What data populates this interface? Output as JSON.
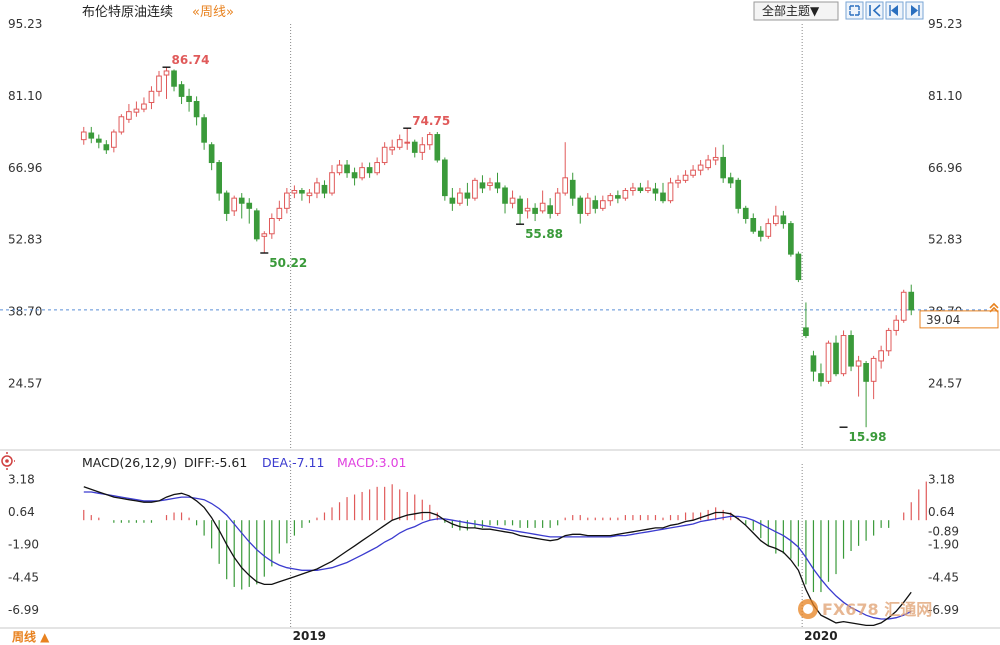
{
  "title": "布伦特原油连续",
  "period_link": "«周线»",
  "theme_button": "全部主题▼",
  "toolbar_icons": [
    "fullscreen-icon",
    "first-icon",
    "prev-icon",
    "next-icon"
  ],
  "bottom_period": "周线 ▲",
  "last_price_label": "39.04",
  "x_labels": [
    "2019",
    "2020"
  ],
  "watermark": "FX678 汇通网",
  "colors": {
    "up": "#e05a5a",
    "down": "#3a9a3a",
    "diff": "#111111",
    "dea": "#3b3bcf",
    "macd_text": "#e040e0",
    "accent": "#e8821f",
    "priceline": "#5a8fd8"
  },
  "macd_legend": {
    "name": "MACD(26,12,9)",
    "diff": "DIFF:-5.61",
    "dea": "DEA:-7.11",
    "macd": "MACD:3.01",
    "current_label": "-0.89"
  },
  "chart_data": [
    {
      "type": "candlestick",
      "title": "布伦特原油连续",
      "y_ticks": [
        95.23,
        81.1,
        66.96,
        52.83,
        38.7,
        24.57
      ],
      "ylim": [
        11.5,
        95.23
      ],
      "current_price": 39.04,
      "annotations": [
        {
          "label": "86.74",
          "value": 86.74,
          "index": 11,
          "kind": "high"
        },
        {
          "label": "50.22",
          "value": 50.22,
          "index": 24,
          "kind": "low"
        },
        {
          "label": "74.75",
          "value": 74.75,
          "index": 43,
          "kind": "high"
        },
        {
          "label": "55.88",
          "value": 55.88,
          "index": 58,
          "kind": "low"
        },
        {
          "label": "15.98",
          "value": 15.98,
          "index": 101,
          "kind": "low"
        }
      ],
      "candles": [
        [
          72.5,
          74.0,
          75.0,
          71.5
        ],
        [
          73.8,
          72.8,
          75.0,
          71.8
        ],
        [
          72.6,
          72.0,
          73.5,
          70.8
        ],
        [
          71.5,
          70.5,
          72.4,
          69.7
        ],
        [
          71.0,
          74.0,
          74.5,
          70.0
        ],
        [
          74.0,
          77.0,
          77.5,
          73.5
        ],
        [
          76.5,
          78.0,
          79.5,
          75.8
        ],
        [
          77.9,
          78.5,
          80.0,
          77.0
        ],
        [
          78.5,
          79.5,
          80.8,
          77.9
        ],
        [
          79.8,
          82.0,
          83.0,
          78.5
        ],
        [
          82.0,
          85.0,
          86.0,
          81.0
        ],
        [
          85.2,
          86.0,
          86.74,
          80.5
        ],
        [
          86.0,
          83.0,
          86.3,
          82.0
        ],
        [
          83.3,
          81.0,
          84.0,
          79.5
        ],
        [
          81.0,
          80.0,
          82.5,
          78.0
        ],
        [
          80.0,
          77.0,
          81.0,
          75.3
        ],
        [
          76.8,
          72.0,
          77.5,
          70.5
        ],
        [
          71.5,
          68.0,
          72.0,
          66.5
        ],
        [
          68.0,
          62.0,
          68.5,
          60.5
        ],
        [
          62.0,
          58.0,
          62.5,
          56.5
        ],
        [
          58.5,
          61.0,
          61.5,
          57.5
        ],
        [
          61.0,
          60.0,
          62.0,
          57.0
        ],
        [
          60.0,
          59.0,
          61.0,
          56.0
        ],
        [
          58.5,
          53.0,
          59.0,
          52.5
        ],
        [
          53.5,
          54.0,
          54.5,
          50.22
        ],
        [
          54.0,
          57.0,
          58.0,
          53.0
        ],
        [
          57.0,
          59.0,
          60.5,
          56.5
        ],
        [
          59.0,
          62.0,
          63.0,
          58.0
        ],
        [
          62.0,
          62.5,
          63.5,
          61.0
        ],
        [
          62.5,
          62.0,
          63.0,
          60.5
        ],
        [
          61.5,
          62.0,
          62.8,
          60.0
        ],
        [
          62.0,
          64.0,
          65.0,
          61.0
        ],
        [
          63.5,
          62.0,
          64.5,
          61.0
        ],
        [
          62.0,
          66.0,
          67.5,
          61.5
        ],
        [
          66.0,
          67.5,
          68.5,
          65.5
        ],
        [
          67.5,
          66.0,
          68.5,
          65.0
        ],
        [
          66.0,
          65.0,
          67.0,
          63.5
        ],
        [
          65.0,
          67.0,
          68.0,
          64.5
        ],
        [
          67.0,
          66.0,
          68.0,
          65.0
        ],
        [
          66.0,
          68.0,
          69.0,
          65.5
        ],
        [
          68.0,
          71.0,
          72.0,
          67.5
        ],
        [
          70.5,
          71.0,
          72.5,
          69.5
        ],
        [
          71.0,
          72.5,
          73.5,
          70.5
        ],
        [
          72.0,
          72.0,
          74.75,
          70.5
        ],
        [
          72.0,
          70.0,
          72.5,
          69.0
        ],
        [
          70.0,
          71.5,
          73.0,
          68.5
        ],
        [
          71.5,
          73.5,
          74.0,
          70.5
        ],
        [
          73.5,
          68.5,
          74.0,
          68.0
        ],
        [
          68.5,
          61.5,
          69.0,
          60.5
        ],
        [
          61.0,
          60.0,
          63.0,
          58.5
        ],
        [
          60.0,
          62.0,
          63.0,
          59.5
        ],
        [
          62.0,
          61.0,
          64.0,
          59.5
        ],
        [
          61.0,
          64.5,
          65.0,
          60.5
        ],
        [
          64.0,
          63.0,
          65.5,
          62.0
        ],
        [
          63.5,
          64.0,
          65.0,
          62.5
        ],
        [
          64.0,
          63.0,
          66.0,
          62.0
        ],
        [
          63.0,
          60.0,
          63.5,
          58.0
        ],
        [
          60.0,
          61.0,
          62.5,
          59.0
        ],
        [
          60.8,
          58.0,
          61.5,
          55.88
        ],
        [
          58.5,
          59.0,
          61.0,
          57.0
        ],
        [
          59.0,
          58.0,
          60.0,
          56.5
        ],
        [
          58.5,
          60.0,
          62.5,
          58.0
        ],
        [
          59.5,
          58.0,
          61.0,
          57.0
        ],
        [
          58.0,
          62.0,
          63.0,
          57.5
        ],
        [
          62.0,
          65.0,
          72.0,
          61.5
        ],
        [
          64.5,
          61.0,
          66.0,
          59.5
        ],
        [
          61.0,
          58.0,
          61.5,
          56.0
        ],
        [
          58.0,
          61.0,
          62.0,
          57.5
        ],
        [
          60.5,
          59.0,
          61.5,
          58.0
        ],
        [
          59.0,
          60.5,
          61.5,
          58.5
        ],
        [
          60.5,
          61.5,
          62.0,
          59.5
        ],
        [
          61.5,
          61.0,
          62.5,
          60.0
        ],
        [
          61.0,
          62.5,
          63.0,
          60.5
        ],
        [
          62.5,
          63.0,
          64.0,
          61.5
        ],
        [
          63.0,
          62.5,
          64.0,
          62.0
        ],
        [
          62.5,
          63.0,
          64.5,
          62.0
        ],
        [
          62.8,
          62.0,
          64.0,
          60.5
        ],
        [
          62.0,
          60.5,
          64.0,
          60.0
        ],
        [
          60.5,
          64.0,
          65.0,
          60.0
        ],
        [
          64.0,
          64.5,
          65.5,
          63.0
        ],
        [
          64.5,
          65.5,
          66.5,
          64.0
        ],
        [
          65.5,
          66.5,
          67.5,
          65.0
        ],
        [
          66.5,
          67.5,
          68.5,
          65.5
        ],
        [
          67.0,
          68.5,
          69.5,
          66.5
        ],
        [
          68.5,
          69.0,
          71.0,
          67.5
        ],
        [
          69.0,
          65.0,
          71.5,
          64.0
        ],
        [
          65.0,
          64.0,
          66.0,
          63.0
        ],
        [
          64.5,
          59.0,
          65.0,
          58.0
        ],
        [
          59.0,
          57.0,
          59.5,
          56.0
        ],
        [
          57.0,
          54.5,
          58.0,
          54.0
        ],
        [
          54.5,
          53.5,
          55.5,
          52.5
        ],
        [
          53.5,
          56.0,
          57.0,
          53.0
        ],
        [
          56.0,
          57.5,
          59.5,
          55.5
        ],
        [
          57.5,
          56.0,
          58.5,
          55.0
        ],
        [
          56.0,
          50.0,
          56.5,
          49.5
        ],
        [
          50.0,
          45.0,
          50.5,
          44.5
        ],
        [
          35.5,
          34.0,
          40.5,
          33.5
        ],
        [
          30.0,
          27.0,
          31.0,
          25.0
        ],
        [
          26.5,
          25.0,
          28.5,
          24.0
        ],
        [
          25.0,
          32.5,
          33.0,
          24.5
        ],
        [
          32.5,
          26.5,
          34.0,
          26.0
        ],
        [
          26.5,
          34.0,
          35.0,
          26.0
        ],
        [
          34.0,
          28.0,
          35.0,
          27.0
        ],
        [
          28.0,
          29.0,
          30.0,
          22.0
        ],
        [
          28.5,
          25.0,
          29.0,
          15.98
        ],
        [
          25.0,
          29.5,
          30.0,
          21.5
        ],
        [
          29.0,
          31.0,
          32.0,
          27.5
        ],
        [
          31.0,
          35.0,
          35.5,
          30.0
        ],
        [
          35.0,
          37.0,
          38.0,
          34.0
        ],
        [
          37.0,
          42.5,
          43.0,
          36.5
        ],
        [
          42.5,
          39.04,
          44.0,
          38.0
        ]
      ]
    },
    {
      "type": "macd",
      "title": "MACD(26,12,9)",
      "y_ticks": [
        3.18,
        0.64,
        -1.9,
        -4.45,
        -6.99
      ],
      "ylim": [
        -8.4,
        3.6
      ],
      "series": [
        {
          "name": "DIFF",
          "values": [
            2.6,
            2.4,
            2.2,
            2.0,
            1.8,
            1.7,
            1.6,
            1.5,
            1.4,
            1.4,
            1.5,
            1.8,
            2.0,
            2.1,
            1.9,
            1.5,
            1.0,
            0.2,
            -0.8,
            -1.9,
            -2.9,
            -3.7,
            -4.3,
            -4.8,
            -5.0,
            -5.0,
            -4.8,
            -4.6,
            -4.4,
            -4.2,
            -4.0,
            -3.8,
            -3.5,
            -3.2,
            -2.8,
            -2.4,
            -2.0,
            -1.6,
            -1.2,
            -0.8,
            -0.4,
            0.0,
            0.2,
            0.4,
            0.5,
            0.6,
            0.6,
            0.4,
            0.0,
            -0.3,
            -0.5,
            -0.6,
            -0.6,
            -0.7,
            -0.7,
            -0.8,
            -0.9,
            -1.0,
            -1.2,
            -1.3,
            -1.4,
            -1.5,
            -1.6,
            -1.5,
            -1.2,
            -1.1,
            -1.1,
            -1.2,
            -1.2,
            -1.2,
            -1.2,
            -1.1,
            -1.0,
            -0.9,
            -0.8,
            -0.7,
            -0.6,
            -0.6,
            -0.4,
            -0.3,
            -0.1,
            0.0,
            0.2,
            0.4,
            0.6,
            0.6,
            0.5,
            0.1,
            -0.4,
            -1.0,
            -1.6,
            -2.0,
            -2.2,
            -2.5,
            -3.1,
            -3.9,
            -5.4,
            -6.6,
            -7.4,
            -7.7,
            -8.0,
            -7.9,
            -8.0,
            -8.1,
            -8.2,
            -8.2,
            -8.0,
            -7.6,
            -7.1,
            -6.4,
            -5.61
          ]
        },
        {
          "name": "DEA",
          "values": [
            2.2,
            2.2,
            2.1,
            2.0,
            1.9,
            1.8,
            1.7,
            1.6,
            1.5,
            1.5,
            1.5,
            1.6,
            1.7,
            1.8,
            1.8,
            1.7,
            1.6,
            1.3,
            0.9,
            0.4,
            -0.3,
            -1.0,
            -1.7,
            -2.3,
            -2.8,
            -3.2,
            -3.5,
            -3.7,
            -3.8,
            -3.9,
            -3.9,
            -3.9,
            -3.8,
            -3.7,
            -3.5,
            -3.3,
            -3.0,
            -2.7,
            -2.4,
            -2.1,
            -1.7,
            -1.4,
            -1.0,
            -0.7,
            -0.5,
            -0.2,
            0.0,
            0.1,
            0.1,
            0.0,
            -0.1,
            -0.2,
            -0.3,
            -0.4,
            -0.5,
            -0.6,
            -0.7,
            -0.8,
            -0.9,
            -1.0,
            -1.1,
            -1.2,
            -1.3,
            -1.3,
            -1.3,
            -1.3,
            -1.3,
            -1.3,
            -1.3,
            -1.3,
            -1.3,
            -1.2,
            -1.2,
            -1.1,
            -1.0,
            -0.9,
            -0.8,
            -0.7,
            -0.6,
            -0.5,
            -0.4,
            -0.3,
            -0.1,
            0.0,
            0.1,
            0.2,
            0.3,
            0.3,
            0.2,
            0.0,
            -0.3,
            -0.6,
            -0.9,
            -1.2,
            -1.6,
            -2.1,
            -2.9,
            -3.8,
            -4.6,
            -5.3,
            -5.9,
            -6.4,
            -6.8,
            -7.1,
            -7.4,
            -7.6,
            -7.7,
            -7.7,
            -7.6,
            -7.4,
            -7.11
          ]
        },
        {
          "name": "MACD",
          "values": [
            0.8,
            0.4,
            0.2,
            0.0,
            -0.2,
            -0.2,
            -0.2,
            -0.2,
            -0.2,
            -0.2,
            0.0,
            0.4,
            0.6,
            0.6,
            0.2,
            -0.4,
            -1.2,
            -2.2,
            -3.4,
            -4.6,
            -5.2,
            -5.4,
            -5.2,
            -5.0,
            -4.4,
            -3.6,
            -2.6,
            -1.8,
            -1.2,
            -0.6,
            -0.2,
            0.2,
            0.6,
            1.0,
            1.4,
            1.8,
            2.0,
            2.2,
            2.4,
            2.6,
            2.6,
            2.8,
            2.4,
            2.2,
            2.0,
            1.6,
            1.2,
            0.6,
            -0.2,
            -0.6,
            -0.8,
            -0.8,
            -0.6,
            -0.6,
            -0.4,
            -0.4,
            -0.4,
            -0.4,
            -0.6,
            -0.6,
            -0.6,
            -0.6,
            -0.6,
            -0.4,
            0.2,
            0.4,
            0.4,
            0.2,
            0.2,
            0.2,
            0.2,
            0.2,
            0.4,
            0.4,
            0.4,
            0.4,
            0.4,
            0.2,
            0.4,
            0.4,
            0.6,
            0.6,
            0.6,
            0.8,
            1.0,
            0.8,
            0.6,
            0.2,
            -0.4,
            -0.8,
            -1.4,
            -2.0,
            -2.6,
            -2.6,
            -3.0,
            -3.6,
            -5.0,
            -5.6,
            -5.6,
            -4.8,
            -4.2,
            -3.0,
            -2.4,
            -2.0,
            -1.6,
            -1.2,
            -0.6,
            -0.6,
            0.0,
            0.6,
            1.4,
            2.4,
            3.01
          ]
        }
      ]
    }
  ]
}
